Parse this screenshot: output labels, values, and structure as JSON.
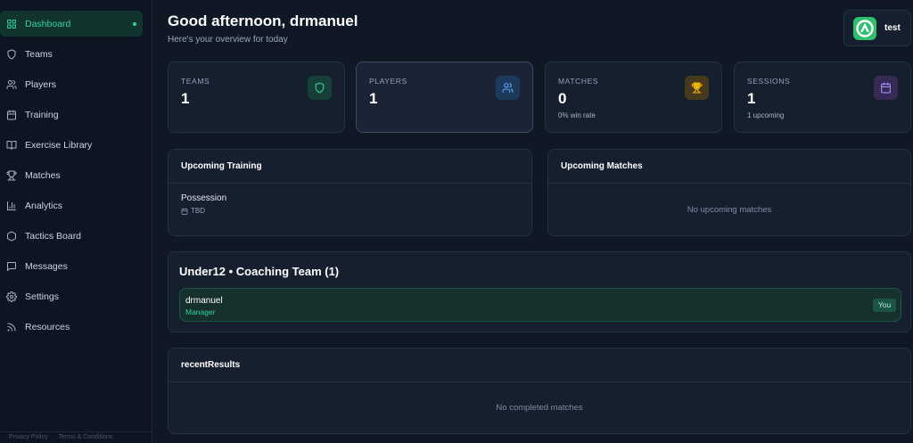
{
  "colors": {
    "accent": "#34d399",
    "page_bg": "#101826",
    "card_bg": "#161f2e",
    "border": "#243044"
  },
  "sidebar": {
    "items": [
      {
        "label": "Dashboard",
        "icon": "layout-grid-icon",
        "active": true
      },
      {
        "label": "Teams",
        "icon": "shield-icon"
      },
      {
        "label": "Players",
        "icon": "users-icon"
      },
      {
        "label": "Training",
        "icon": "calendar-icon"
      },
      {
        "label": "Exercise Library",
        "icon": "book-open-icon"
      },
      {
        "label": "Matches",
        "icon": "trophy-icon"
      },
      {
        "label": "Analytics",
        "icon": "bar-chart-icon"
      },
      {
        "label": "Tactics Board",
        "icon": "hexagon-icon"
      },
      {
        "label": "Messages",
        "icon": "message-icon"
      },
      {
        "label": "Settings",
        "icon": "gear-icon"
      },
      {
        "label": "Resources",
        "icon": "rss-icon"
      }
    ],
    "footer": {
      "privacy": "Privacy Policy",
      "terms": "Terms & Conditions"
    }
  },
  "header": {
    "greeting": "Good afternoon, drmanuel",
    "subtitle": "Here's your overview for today"
  },
  "user": {
    "name": "test",
    "avatar_icon": "team-logo-icon"
  },
  "stats": [
    {
      "label": "TEAMS",
      "value": "1",
      "icon": "shield-icon",
      "color": "#34d399",
      "tint": "#153f38"
    },
    {
      "label": "PLAYERS",
      "value": "1",
      "icon": "users-icon",
      "color": "#60a5fa",
      "tint": "#1b3a5c"
    },
    {
      "label": "MATCHES",
      "value": "0",
      "sub": "0% win rate",
      "icon": "trophy-icon",
      "color": "#eab308",
      "tint": "#45391e"
    },
    {
      "label": "SESSIONS",
      "value": "1",
      "sub": "1 upcoming",
      "icon": "calendar-icon",
      "color": "#a78bfa",
      "tint": "#362a55"
    }
  ],
  "upcoming_training": {
    "title": "Upcoming Training",
    "items": [
      {
        "name": "Possession",
        "date": "TBD"
      }
    ]
  },
  "upcoming_matches": {
    "title": "Upcoming Matches",
    "empty": "No upcoming matches"
  },
  "team": {
    "title": "Under12 • Coaching Team (1)",
    "members": [
      {
        "name": "drmanuel",
        "role": "Manager",
        "badge": "You"
      }
    ]
  },
  "recent_results": {
    "title": "recentResults",
    "empty": "No completed matches"
  }
}
